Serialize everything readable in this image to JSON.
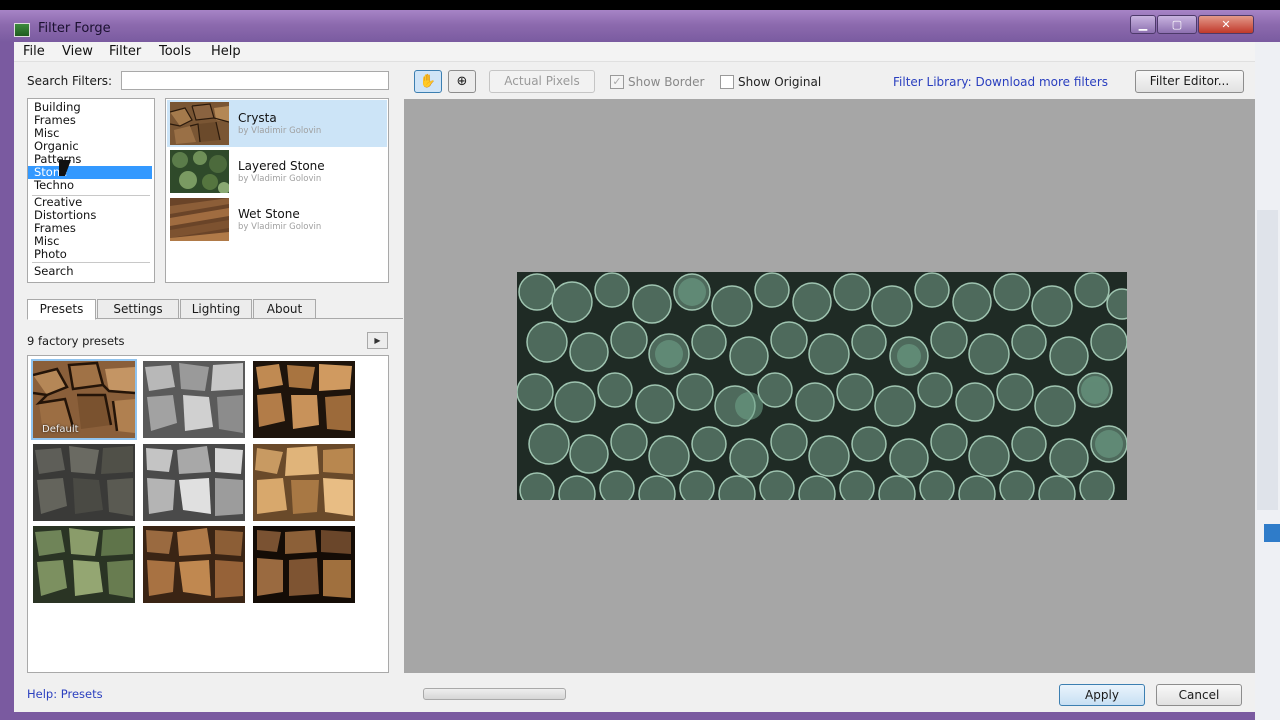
{
  "window": {
    "title": "Filter Forge"
  },
  "menu": [
    "File",
    "View",
    "Filter",
    "Tools",
    "Help"
  ],
  "search": {
    "label": "Search Filters:",
    "value": ""
  },
  "categories": [
    {
      "label": "Building",
      "selected": false
    },
    {
      "label": "Frames",
      "selected": false
    },
    {
      "label": "Misc",
      "selected": false
    },
    {
      "label": "Organic",
      "selected": false
    },
    {
      "label": "Patterns",
      "selected": false
    },
    {
      "label": "Stone",
      "selected": true
    },
    {
      "label": "Techno",
      "selected": false
    },
    {
      "label": "Creative",
      "selected": false
    },
    {
      "label": "Distortions",
      "selected": false
    },
    {
      "label": "Frames",
      "selected": false
    },
    {
      "label": "Misc",
      "selected": false
    },
    {
      "label": "Photo",
      "selected": false
    },
    {
      "label": "Search",
      "selected": false
    }
  ],
  "filters": [
    {
      "name": "Crysta",
      "author": "by Vladimir Golovin",
      "selected": true
    },
    {
      "name": "Layered Stone",
      "author": "by Vladimir Golovin",
      "selected": false
    },
    {
      "name": "Wet Stone",
      "author": "by Vladimir Golovin",
      "selected": false
    }
  ],
  "tabs": [
    {
      "label": "Presets",
      "active": true
    },
    {
      "label": "Settings",
      "active": false
    },
    {
      "label": "Lighting",
      "active": false
    },
    {
      "label": "About",
      "active": false
    }
  ],
  "presets": {
    "count_text": "9 factory presets",
    "default_label": "Default"
  },
  "help_link": "Help: Presets",
  "toolbar": {
    "actual_pixels": "Actual Pixels",
    "show_border": "Show Border",
    "show_border_checked": true,
    "show_original": "Show Original",
    "show_original_checked": false,
    "library_link": "Filter Library: Download more filters",
    "filter_editor": "Filter Editor..."
  },
  "buttons": {
    "apply": "Apply",
    "cancel": "Cancel"
  },
  "colors": {
    "selection": "#3399ff",
    "link": "#2a3fbf",
    "preview_bg": "#a6a6a6",
    "titlebar": "#8c6aae"
  }
}
